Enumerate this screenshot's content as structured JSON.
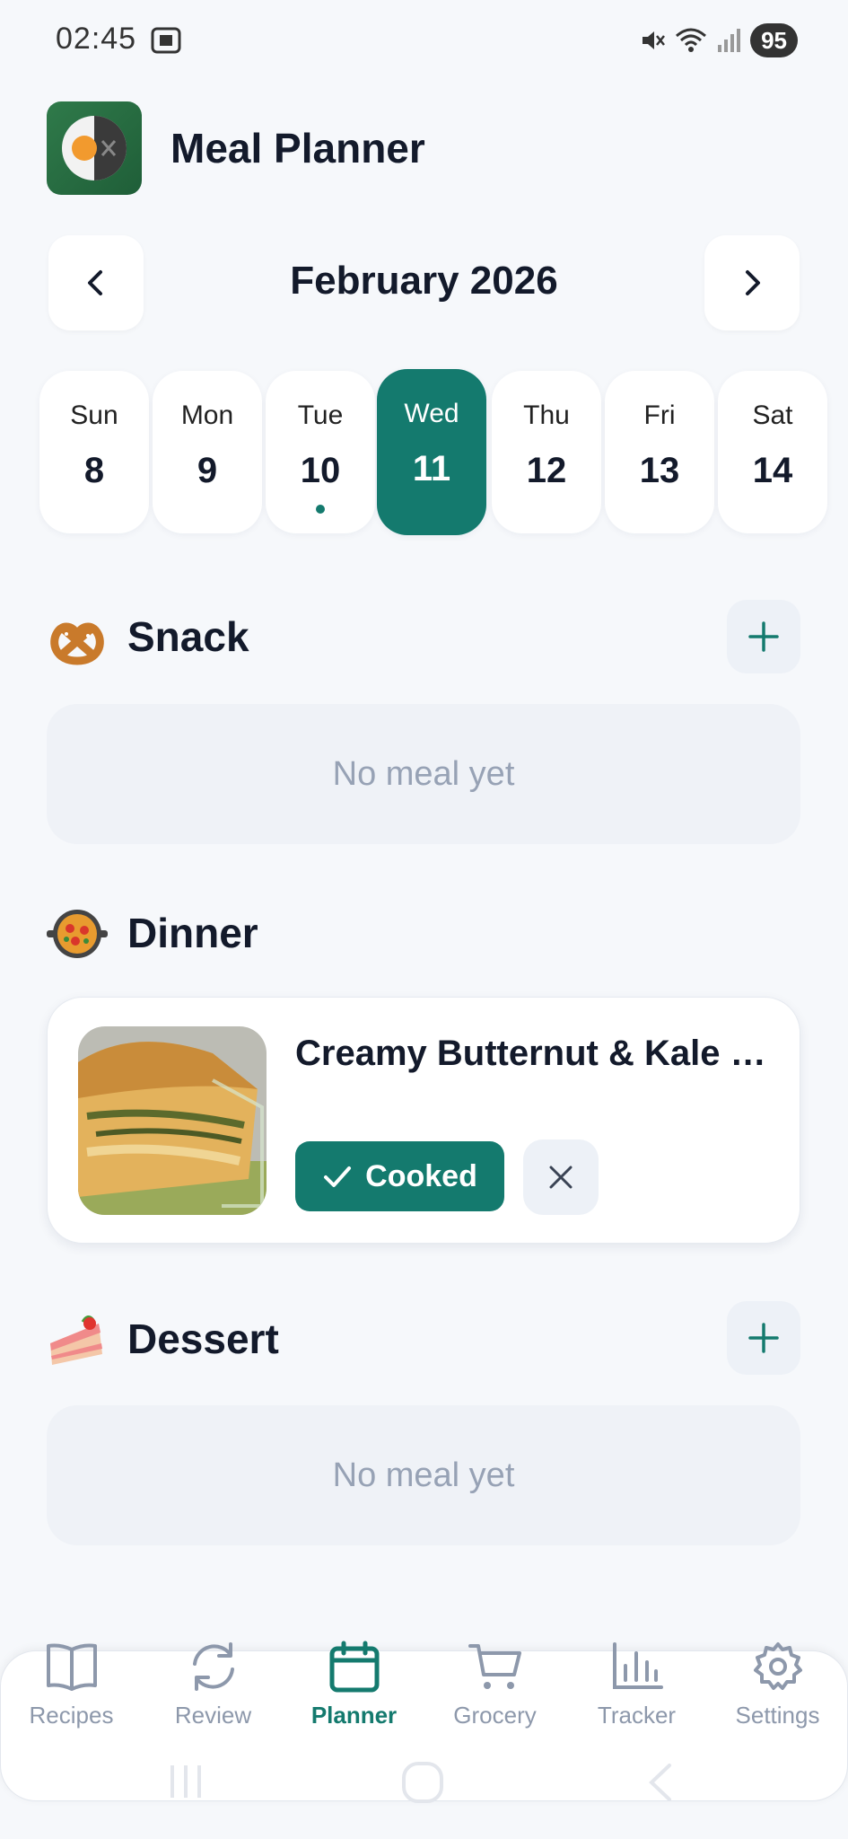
{
  "status_bar": {
    "time": "02:45",
    "battery": "95"
  },
  "header": {
    "title": "Meal Planner"
  },
  "calendar": {
    "month_label": "February 2026",
    "days": [
      {
        "name": "Sun",
        "num": "8"
      },
      {
        "name": "Mon",
        "num": "9"
      },
      {
        "name": "Tue",
        "num": "10",
        "has_meal_dot": true
      },
      {
        "name": "Wed",
        "num": "11",
        "selected": true
      },
      {
        "name": "Thu",
        "num": "12"
      },
      {
        "name": "Fri",
        "num": "13"
      },
      {
        "name": "Sat",
        "num": "14"
      }
    ]
  },
  "sections": {
    "snack": {
      "title": "Snack",
      "empty_text": "No meal yet",
      "icon": "pretzel-icon"
    },
    "dinner": {
      "title": "Dinner",
      "icon": "paella-icon",
      "meal": {
        "name": "Creamy Butternut & Kale Lasagna",
        "cooked_label": "Cooked"
      }
    },
    "dessert": {
      "title": "Dessert",
      "empty_text": "No meal yet",
      "icon": "cake-icon"
    }
  },
  "bottom_nav": {
    "items": [
      {
        "label": "Recipes",
        "icon": "book-icon"
      },
      {
        "label": "Review",
        "icon": "refresh-icon"
      },
      {
        "label": "Planner",
        "icon": "calendar-icon",
        "active": true
      },
      {
        "label": "Grocery",
        "icon": "cart-icon"
      },
      {
        "label": "Tracker",
        "icon": "bar-chart-icon"
      },
      {
        "label": "Settings",
        "icon": "gear-icon"
      }
    ]
  },
  "colors": {
    "accent": "#147a6e",
    "background": "#f6f8fb",
    "muted": "#97a2b5"
  }
}
